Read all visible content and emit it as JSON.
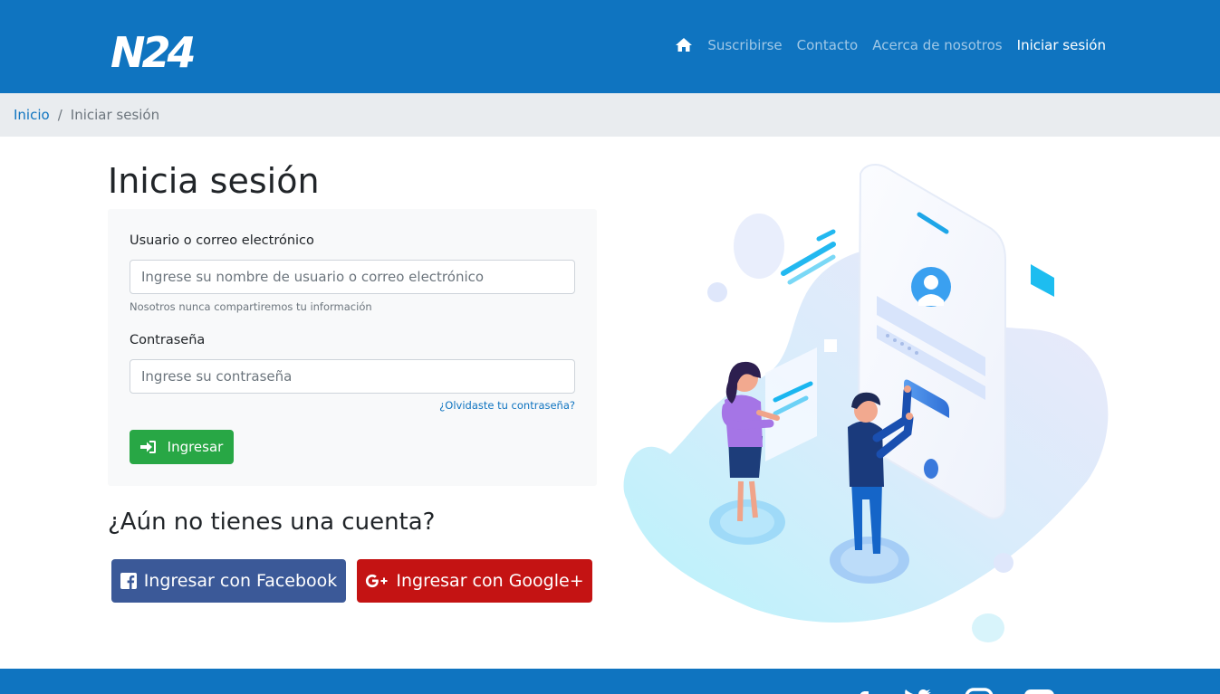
{
  "header": {
    "logo_text": "N24",
    "nav": {
      "home_icon": "home-icon",
      "items": [
        "Suscribirse",
        "Contacto",
        "Acerca de nosotros",
        "Iniciar sesión"
      ],
      "active_index": 3
    }
  },
  "breadcrumb": {
    "home": "Inicio",
    "separator": "/",
    "current": "Iniciar sesión"
  },
  "login": {
    "title": "Inicia sesión",
    "username_label": "Usuario o correo electrónico",
    "username_placeholder": "Ingrese su nombre de usuario o correo electrónico",
    "username_help": "Nosotros nunca compartiremos tu información",
    "password_label": "Contraseña",
    "password_placeholder": "Ingrese su contraseña",
    "forgot_link": "¿Olvidaste tu contraseña?",
    "submit_label": "Ingresar"
  },
  "signup": {
    "title": "¿Aún no tienes una cuenta?",
    "facebook_label": "Ingresar con Facebook",
    "google_label": "Ingresar con Google+"
  },
  "footer": {
    "social_icons": [
      "facebook-icon",
      "twitter-icon",
      "instagram-icon",
      "youtube-icon"
    ]
  },
  "colors": {
    "primary": "#0f74c0",
    "success": "#28a745",
    "facebook": "#3b5998",
    "google": "#c41313"
  }
}
